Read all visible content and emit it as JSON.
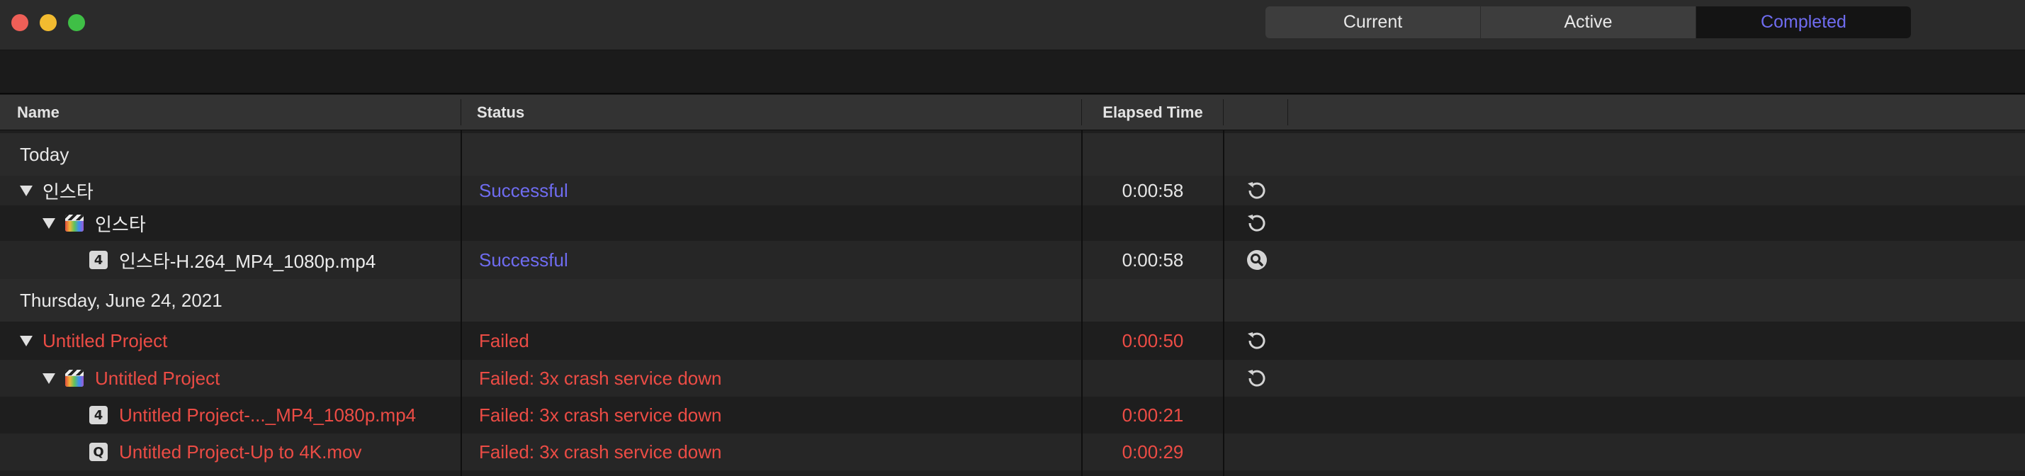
{
  "window": {
    "tabs": [
      {
        "label": "Current"
      },
      {
        "label": "Active"
      },
      {
        "label": "Completed"
      }
    ],
    "active_tab": "Completed"
  },
  "table": {
    "columns": {
      "name": "Name",
      "status": "Status",
      "elapsed": "Elapsed Time"
    }
  },
  "groups": [
    {
      "label": "Today",
      "rows": [
        {
          "name": "인스타",
          "status": "Successful",
          "elapsed": "0:00:58",
          "icon": "disclosure-triangle",
          "action_icon": "retry-icon",
          "state": "success"
        },
        {
          "name": "인스타",
          "status": "",
          "elapsed": "",
          "icon": "fcp-clapper-icon",
          "action_icon": "retry-icon",
          "state": "success"
        },
        {
          "name": "인스타-H.264_MP4_1080p.mp4",
          "status": "Successful",
          "elapsed": "0:00:58",
          "icon": "mp4-file-badge",
          "badge": "4",
          "action_icon": "reveal-magnifier-icon",
          "state": "success"
        }
      ]
    },
    {
      "label": "Thursday, June 24, 2021",
      "rows": [
        {
          "name": "Untitled Project",
          "status": "Failed",
          "elapsed": "0:00:50",
          "icon": "disclosure-triangle",
          "action_icon": "retry-icon",
          "state": "failed"
        },
        {
          "name": "Untitled Project",
          "status": "Failed: 3x crash service down",
          "elapsed": "",
          "icon": "fcp-clapper-icon",
          "action_icon": "retry-icon",
          "state": "failed"
        },
        {
          "name": "Untitled Project-..._MP4_1080p.mp4",
          "status": "Failed: 3x crash service down",
          "elapsed": "0:00:21",
          "icon": "mp4-file-badge",
          "badge": "4",
          "action_icon": "",
          "state": "failed"
        },
        {
          "name": "Untitled Project-Up to 4K.mov",
          "status": "Failed: 3x crash service down",
          "elapsed": "0:00:29",
          "icon": "mov-file-badge",
          "badge": "Q",
          "action_icon": "",
          "state": "failed"
        }
      ]
    }
  ],
  "colors": {
    "success": "#6f6cf0",
    "failed": "#ec4c45",
    "accent_tab": "#6f6cf0"
  }
}
